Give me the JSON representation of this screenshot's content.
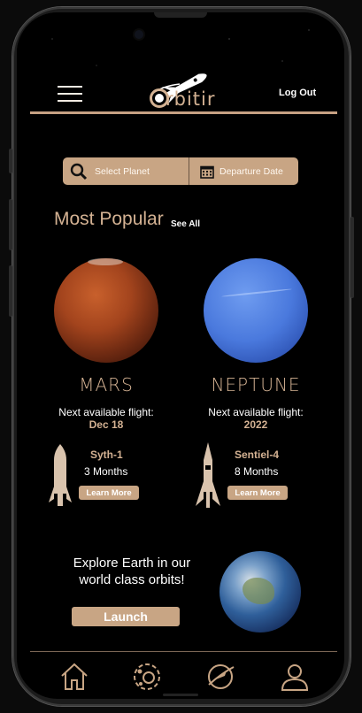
{
  "app": {
    "name": "rbitir",
    "logo_letter": "O"
  },
  "header": {
    "logout_label": "Log Out"
  },
  "search": {
    "planet_placeholder": "Select Planet",
    "date_placeholder": "Departure Date"
  },
  "popular": {
    "title": "Most Popular",
    "see_all": "See All",
    "planets": [
      {
        "name": "MARS",
        "next_label": "Next available flight:",
        "next_date": "Dec 18",
        "ship": "Syth-1",
        "duration": "3 Months",
        "learn_more": "Learn More"
      },
      {
        "name": "NEPTUNE",
        "next_label": "Next available flight:",
        "next_date": "2022",
        "ship": "Sentiel-4",
        "duration": "8 Months",
        "learn_more": "Learn More"
      }
    ]
  },
  "promo": {
    "text": "Explore Earth in our world class orbits!",
    "cta": "Launch"
  },
  "nav": {
    "items": [
      "home-icon",
      "planets-icon",
      "orbit-icon",
      "profile-icon"
    ]
  },
  "colors": {
    "accent": "#c8a584",
    "accent_text": "#d4b293",
    "background": "#000000"
  }
}
